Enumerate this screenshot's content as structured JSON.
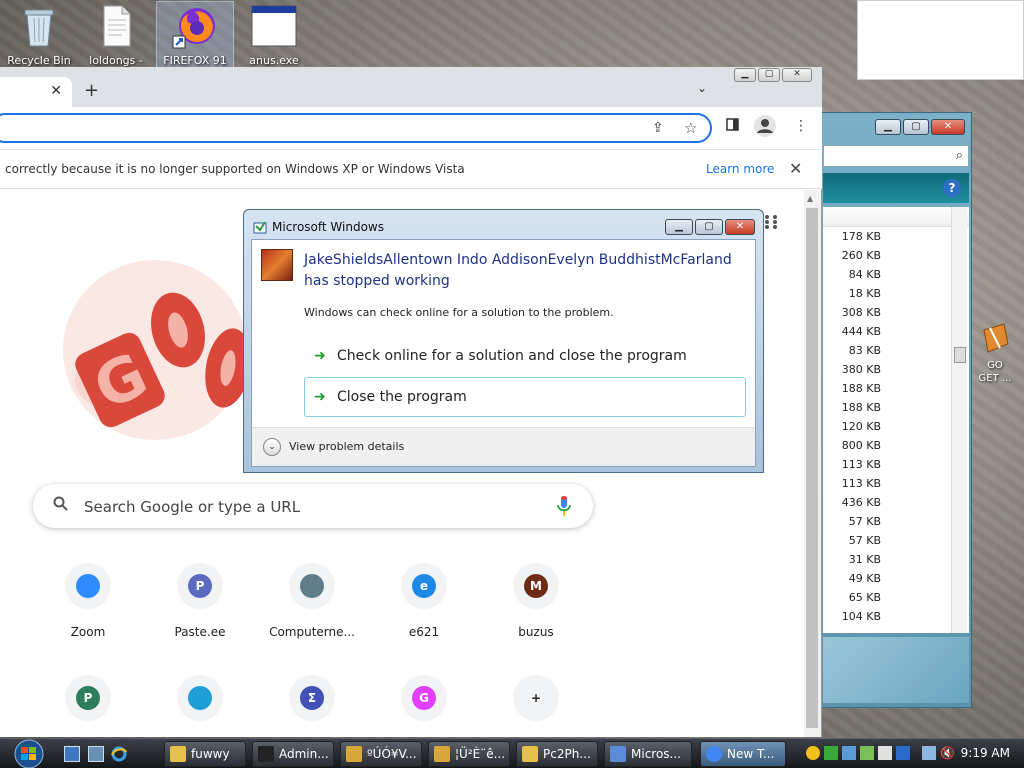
{
  "desktop": {
    "icons": [
      {
        "label": "Recycle Bin",
        "name": "recycle-bin-icon"
      },
      {
        "label": "loldongs -",
        "name": "document-icon"
      },
      {
        "label": "FIREFOX 91",
        "name": "firefox-icon"
      },
      {
        "label": "anus.exe",
        "name": "exe-window-icon"
      }
    ],
    "cut_icon_label": "GO\nGET ..."
  },
  "explorer": {
    "sizes": [
      "178 KB",
      "260 KB",
      "84 KB",
      "18 KB",
      "308 KB",
      "444 KB",
      "83 KB",
      "380 KB",
      "188 KB",
      "188 KB",
      "120 KB",
      "800 KB",
      "113 KB",
      "113 KB",
      "436 KB",
      "57 KB",
      "57 KB",
      "31 KB",
      "49 KB",
      "65 KB",
      "104 KB"
    ],
    "help": "?"
  },
  "chrome": {
    "tab_close": "✕",
    "new_tab": "+",
    "infobar": {
      "message": "correctly because it is no longer supported on Windows XP or Windows Vista",
      "learn_more": "Learn more",
      "close": "✕"
    },
    "search": {
      "placeholder": "Search Google or type a URL"
    },
    "shortcuts": [
      {
        "label": "Zoom",
        "letter": "",
        "color": "#2d8cff"
      },
      {
        "label": "Paste.ee",
        "letter": "P",
        "color": "#5c6bc0"
      },
      {
        "label": "Computerne...",
        "letter": "",
        "color": "#607d8b"
      },
      {
        "label": "e621",
        "letter": "e",
        "color": "#1e88e5"
      },
      {
        "label": "buzus",
        "letter": "M",
        "color": "#6d2b16"
      },
      {
        "label": "",
        "letter": "P",
        "color": "#2e7d5b"
      },
      {
        "label": "",
        "letter": "",
        "color": "#1e9fd6"
      },
      {
        "label": "",
        "letter": "Σ",
        "color": "#3f51b5"
      },
      {
        "label": "",
        "letter": "G",
        "color": "#e040fb"
      },
      {
        "label": "",
        "letter": "+",
        "color": "#f1f3f4"
      }
    ]
  },
  "dialog": {
    "title": "Microsoft Windows",
    "heading": "JakeShieldsAllentown Indo AddisonEvelyn BuddhistMcFarland has stopped working",
    "subtext": "Windows can check online for a solution to the problem.",
    "option1": "Check online for a solution and close the program",
    "option2": "Close the program",
    "details": "View problem details"
  },
  "taskbar": {
    "buttons": [
      {
        "label": "fuwwy",
        "icon": "folder-icon"
      },
      {
        "label": "Admin...",
        "icon": "cmd-icon"
      },
      {
        "label": "ºÚÓ¥V...",
        "icon": "app-icon"
      },
      {
        "label": "¦Ü²È¨ê...",
        "icon": "app-icon"
      },
      {
        "label": "Pc2Ph...",
        "icon": "folder-icon"
      },
      {
        "label": "Micros...",
        "icon": "windows-icon"
      },
      {
        "label": "New T...",
        "icon": "chrome-icon"
      }
    ],
    "clock": "9:19 AM"
  }
}
